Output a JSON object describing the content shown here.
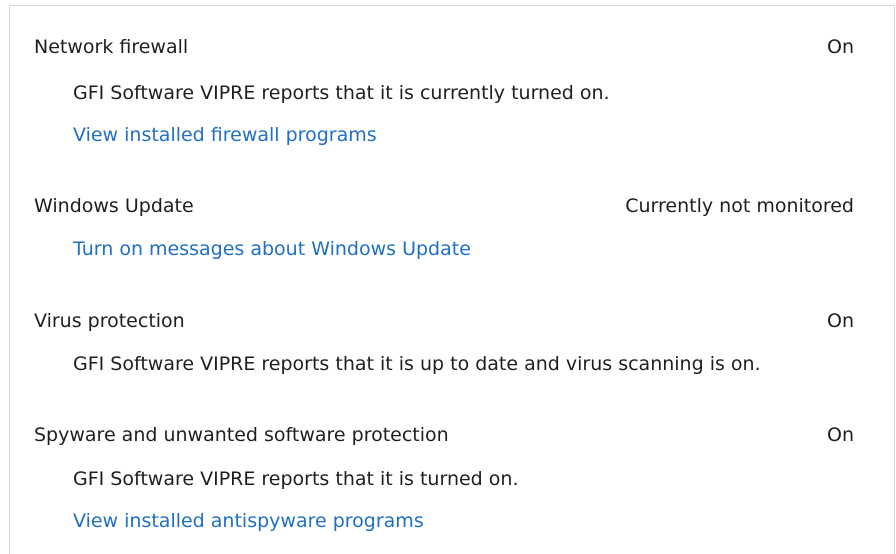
{
  "sections": [
    {
      "name": "Network firewall",
      "status": "On",
      "detail": "GFI Software VIPRE reports that it is currently turned on.",
      "link": "View installed firewall programs"
    },
    {
      "name": "Windows Update",
      "status": "Currently not monitored",
      "link": "Turn on messages about Windows Update"
    },
    {
      "name": "Virus protection",
      "status": "On",
      "detail": "GFI Software VIPRE reports that it is up to date and virus scanning is on."
    },
    {
      "name": "Spyware and unwanted software protection",
      "status": "On",
      "detail": "GFI Software VIPRE reports that it is turned on.",
      "link": "View installed antispyware programs"
    }
  ],
  "colors": {
    "link": "#1f6fc5",
    "text": "#1e1e1e",
    "border": "#d5d5d5"
  }
}
